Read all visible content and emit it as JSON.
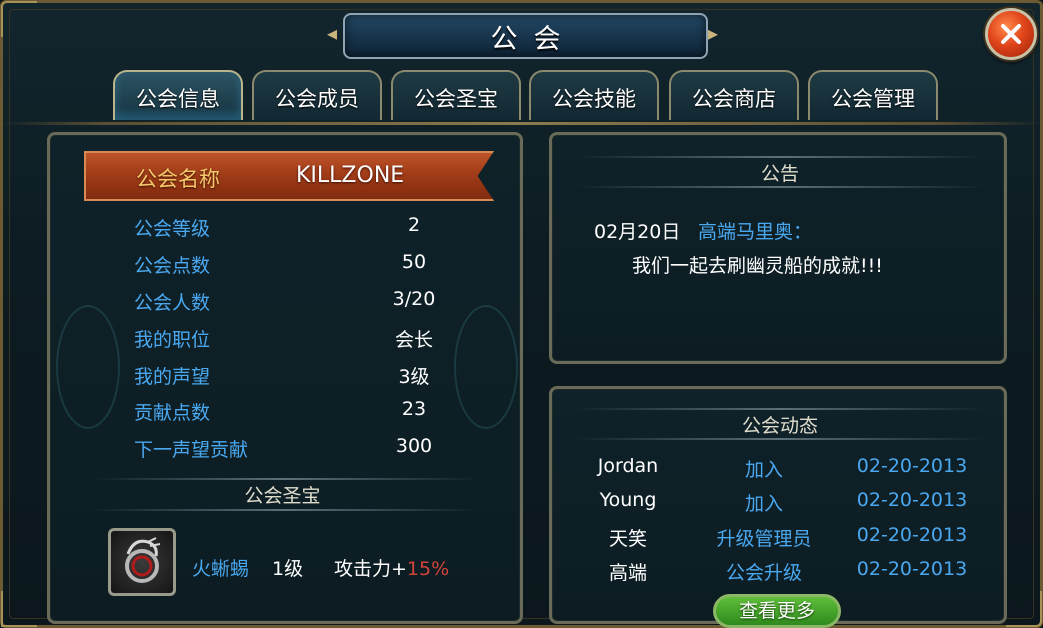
{
  "window": {
    "title": "公会"
  },
  "tabs": [
    {
      "label": "公会信息",
      "active": true
    },
    {
      "label": "公会成员",
      "active": false
    },
    {
      "label": "公会圣宝",
      "active": false
    },
    {
      "label": "公会技能",
      "active": false
    },
    {
      "label": "公会商店",
      "active": false
    },
    {
      "label": "公会管理",
      "active": false
    }
  ],
  "guild": {
    "name_label": "公会名称",
    "name_value": "KILLZONE",
    "stats": [
      {
        "label": "公会等级",
        "value": "2"
      },
      {
        "label": "公会点数",
        "value": "50"
      },
      {
        "label": "公会人数",
        "value": "3/20"
      },
      {
        "label": "我的职位",
        "value": "会长"
      },
      {
        "label": "我的声望",
        "value": "3级"
      },
      {
        "label": "贡献点数",
        "value": "23"
      },
      {
        "label": "下一声望贡献",
        "value": "300"
      }
    ]
  },
  "treasure": {
    "section_title": "公会圣宝",
    "icon": "dragon-icon",
    "name": "火蜥蜴",
    "level": "1级",
    "attr_label": "攻击力+",
    "attr_value": "15%"
  },
  "notice": {
    "title": "公告",
    "date": "02月20日",
    "author": "高端马里奥：",
    "body": "我们一起去刷幽灵船的成就!!!"
  },
  "news": {
    "title": "公会动态",
    "rows": [
      {
        "user": "Jordan",
        "action": "加入",
        "date": "02-20-2013"
      },
      {
        "user": "Young",
        "action": "加入",
        "date": "02-20-2013"
      },
      {
        "user": "天笑",
        "action": "升级管理员",
        "date": "02-20-2013"
      },
      {
        "user": "高端",
        "action": "公会升级",
        "date": "02-20-2013"
      }
    ],
    "more_label": "查看更多"
  },
  "colors": {
    "accent_blue": "#4aa8f0",
    "banner_orange": "#9e3a17",
    "attr_red": "#d2443a",
    "close_red": "#e0441a",
    "more_green": "#2f8a1e"
  }
}
